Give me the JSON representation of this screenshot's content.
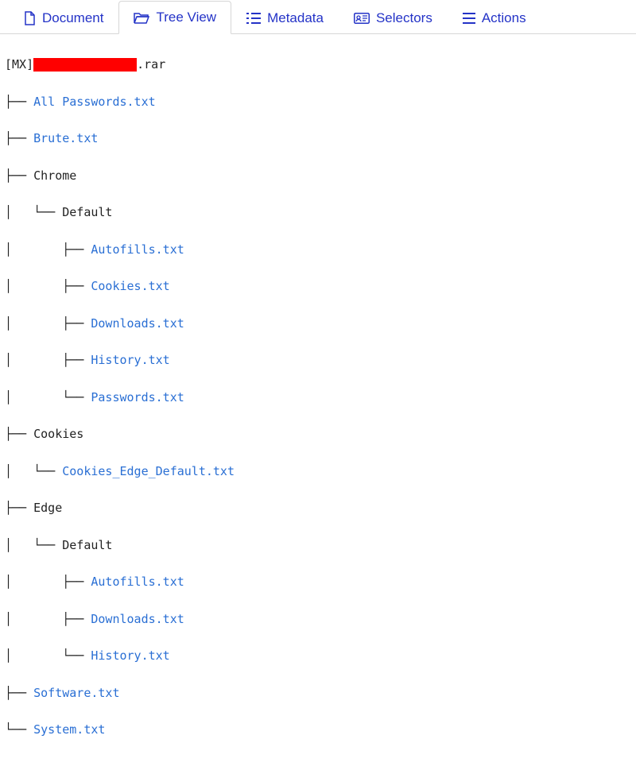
{
  "tabs": {
    "document": "Document",
    "treeview": "Tree View",
    "metadata": "Metadata",
    "selectors": "Selectors",
    "actions": "Actions"
  },
  "root": {
    "prefix": "[MX]",
    "suffix": ".rar"
  },
  "lines": {
    "l0_prefix": "├── ",
    "l0_name": "All Passwords.txt",
    "l1_prefix": "├── ",
    "l1_name": "Brute.txt",
    "l2_prefix": "├── ",
    "l2_name": "Chrome",
    "l3_prefix": "│   └── ",
    "l3_name": "Default",
    "l4_prefix": "│       ├── ",
    "l4_name": "Autofills.txt",
    "l5_prefix": "│       ├── ",
    "l5_name": "Cookies.txt",
    "l6_prefix": "│       ├── ",
    "l6_name": "Downloads.txt",
    "l7_prefix": "│       ├── ",
    "l7_name": "History.txt",
    "l8_prefix": "│       └── ",
    "l8_name": "Passwords.txt",
    "l9_prefix": "├── ",
    "l9_name": "Cookies",
    "l10_prefix": "│   └── ",
    "l10_name": "Cookies_Edge_Default.txt",
    "l11_prefix": "├── ",
    "l11_name": "Edge",
    "l12_prefix": "│   └── ",
    "l12_name": "Default",
    "l13_prefix": "│       ├── ",
    "l13_name": "Autofills.txt",
    "l14_prefix": "│       ├── ",
    "l14_name": "Downloads.txt",
    "l15_prefix": "│       └── ",
    "l15_name": "History.txt",
    "l16_prefix": "├── ",
    "l16_name": "Software.txt",
    "l17_prefix": "└── ",
    "l17_name": "System.txt"
  }
}
